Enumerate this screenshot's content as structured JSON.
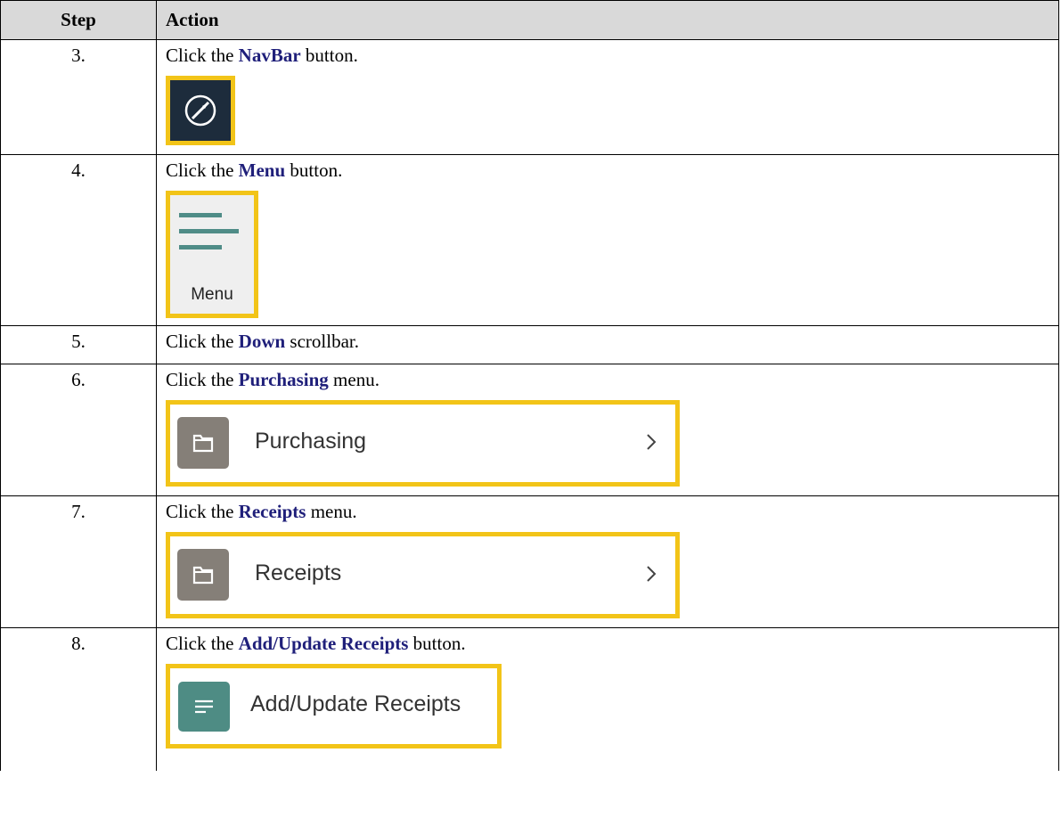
{
  "table": {
    "header_step": "Step",
    "header_action": "Action"
  },
  "rows": [
    {
      "step": "3.",
      "prefix": "Click the ",
      "target": "NavBar",
      "suffix": " button."
    },
    {
      "step": "4.",
      "prefix": "Click the ",
      "target": "Menu",
      "suffix": " button.",
      "image_label": "Menu"
    },
    {
      "step": "5.",
      "prefix": "Click the ",
      "target": "Down",
      "suffix": " scrollbar."
    },
    {
      "step": "6.",
      "prefix": "Click the ",
      "target": "Purchasing",
      "suffix": " menu.",
      "image_label": "Purchasing"
    },
    {
      "step": "7.",
      "prefix": "Click the ",
      "target": "Receipts",
      "suffix": " menu.",
      "image_label": "Receipts"
    },
    {
      "step": "8.",
      "prefix": "Click the ",
      "target": "Add/Update Receipts",
      "suffix": " button.",
      "image_label": "Add/Update Receipts"
    }
  ],
  "icons": {
    "navbar": "compass-icon",
    "menu": "hamburger-menu-icon",
    "folder": "folder-icon",
    "chevron": "chevron-right-icon",
    "app": "list-lines-icon"
  },
  "colors": {
    "highlight": "#f2c418",
    "header_bg": "#d9d9d9",
    "bold_text": "#1f1f7a",
    "navbar_bg": "#1d2c3c",
    "menu_lines": "#4f8c87",
    "folder_tile": "#857f78",
    "app_tile": "#4e8c84"
  }
}
